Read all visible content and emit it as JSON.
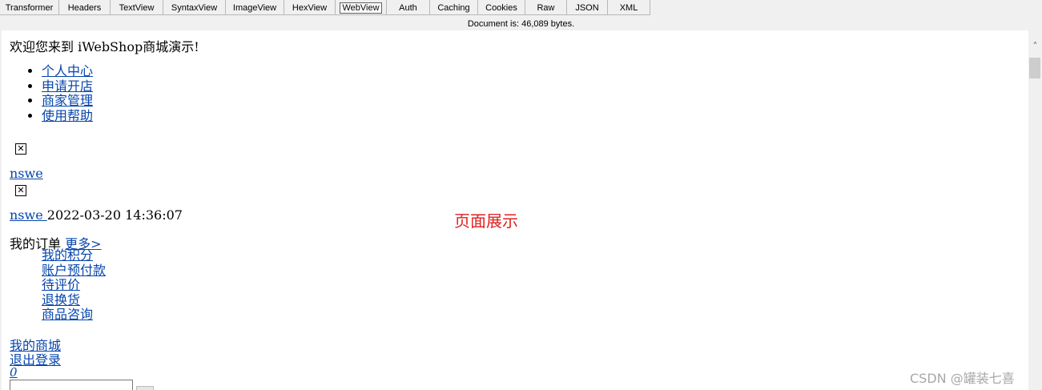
{
  "tabs": [
    {
      "label": "Transformer"
    },
    {
      "label": "Headers"
    },
    {
      "label": "TextView"
    },
    {
      "label": "SyntaxView"
    },
    {
      "label": "ImageView"
    },
    {
      "label": "HexView"
    },
    {
      "label": "WebView"
    },
    {
      "label": "Auth"
    },
    {
      "label": "Caching"
    },
    {
      "label": "Cookies"
    },
    {
      "label": "Raw"
    },
    {
      "label": "JSON"
    },
    {
      "label": "XML"
    }
  ],
  "status": "Document is: 46,089 bytes.",
  "page": {
    "welcome": "欢迎您来到 iWebShop商城演示!",
    "topnav": [
      "个人中心",
      "申请开店",
      "商家管理",
      "使用帮助"
    ],
    "username": "nswe",
    "username2": "nswe ",
    "timestamp": "2022-03-20 14:36:07",
    "orders_label": "我的订单",
    "more_link": "更多>",
    "account_links": [
      "我的积分",
      "账户预付款",
      "待评价",
      "退换货",
      "商品咨询"
    ],
    "my_shop": "我的商城",
    "logout": "退出登录",
    "cart_count": "0"
  },
  "annotation": "页面展示",
  "watermark": "CSDN @罐装七喜",
  "broken_image_glyph": "✕"
}
